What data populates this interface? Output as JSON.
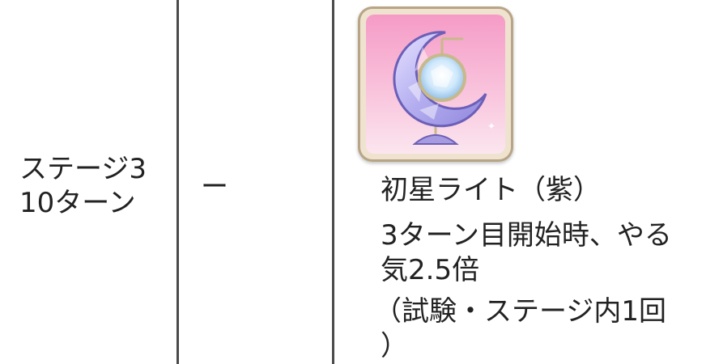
{
  "row": {
    "condition": "ステージ3\n10ターン",
    "dash": "ー",
    "item": {
      "icon": "crescent-moon-lamp-icon",
      "name": "初星ライト（紫）",
      "effect_line1": "3ターン目開始時、やる",
      "effect_line2": "気2.5倍",
      "limit_line1": "（試験・ステージ内1回",
      "limit_line2": "）"
    }
  },
  "colors": {
    "border": "#4a4a4a",
    "icon_bg_top": "#f59bc6",
    "icon_bg_bottom": "#fbe6ef",
    "moon": "#b9b3f0"
  }
}
